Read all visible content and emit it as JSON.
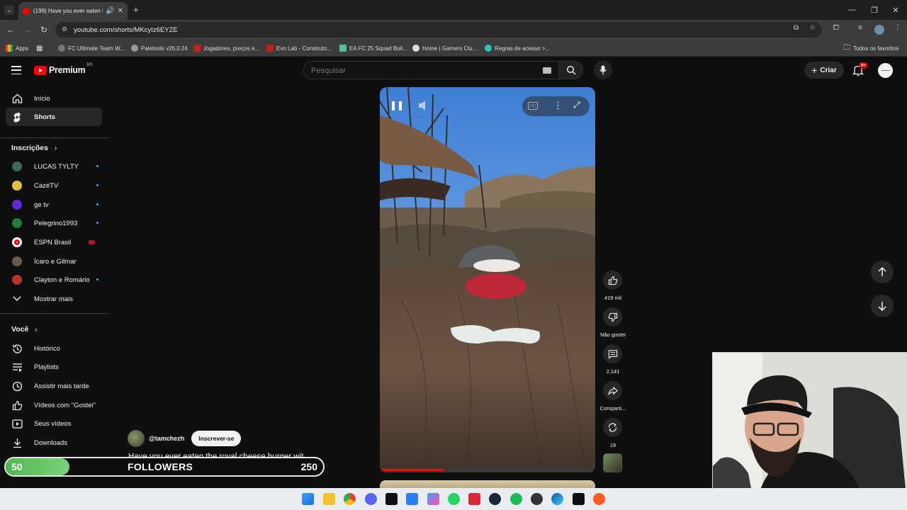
{
  "browser": {
    "tab_title": "(199) Have you ever eaten t",
    "url": "youtube.com/shorts/MKcyIz6EYZE",
    "bookmarks": [
      "Apps",
      "FC Ultimate Team W...",
      "Paletools v26.0.24",
      "Jogadores, preços e...",
      "Evo Lab - Construto...",
      "EA FC 25 Squad Buil...",
      "Home | Gamers Clu...",
      "Regras de acesso >...",
      "Todos os favoritos"
    ]
  },
  "header": {
    "logo_text": "Premium",
    "region": "BR",
    "search_placeholder": "Pesquisar",
    "create_label": "Criar",
    "notification_count": "9+"
  },
  "sidebar": {
    "main_items": [
      {
        "label": "Início",
        "icon": "home-icon"
      },
      {
        "label": "Shorts",
        "icon": "shorts-icon",
        "active": true
      }
    ],
    "subscriptions_title": "Inscrições",
    "subscriptions": [
      {
        "label": "LUCAS TYLTY",
        "color": "#3a6b5a",
        "live": false
      },
      {
        "label": "CazéTV",
        "color": "#e0c040",
        "live": false
      },
      {
        "label": "ge tv",
        "color": "#5b2bd6",
        "live": false
      },
      {
        "label": "Pelegrino1993",
        "color": "#1e7d3a",
        "live": false
      },
      {
        "label": "ESPN Brasil",
        "color": "#ffffff",
        "live": true
      },
      {
        "label": "Ícaro e Gilmar",
        "color": "#6b5a4a",
        "live": false
      },
      {
        "label": "Clayton e Romário",
        "color": "#b8352c",
        "live": false
      }
    ],
    "show_more": "Mostrar mais",
    "you_title": "Você",
    "you_items": [
      {
        "label": "Histórico",
        "icon": "history-icon"
      },
      {
        "label": "Playlists",
        "icon": "playlists-icon"
      },
      {
        "label": "Assistir mais tarde",
        "icon": "watch-later-icon"
      },
      {
        "label": "Vídeos com \"Gostei\"",
        "icon": "like-icon"
      },
      {
        "label": "Seus vídeos",
        "icon": "your-videos-icon"
      },
      {
        "label": "Downloads",
        "icon": "downloads-icon"
      }
    ]
  },
  "short": {
    "channel": "@tamchezh",
    "subscribe_label": "Inscrever-se",
    "title": "Have you ever eaten the royal cheese burger wit...",
    "progress": 0.3,
    "actions": {
      "likes": "419 mil",
      "dislike": "Não gostei",
      "comments": "2.141",
      "share": "Comparti...",
      "remix": "19"
    }
  },
  "overlay": {
    "current": "50",
    "label": "FOLLOWERS",
    "goal": "250",
    "fill": 0.2
  }
}
